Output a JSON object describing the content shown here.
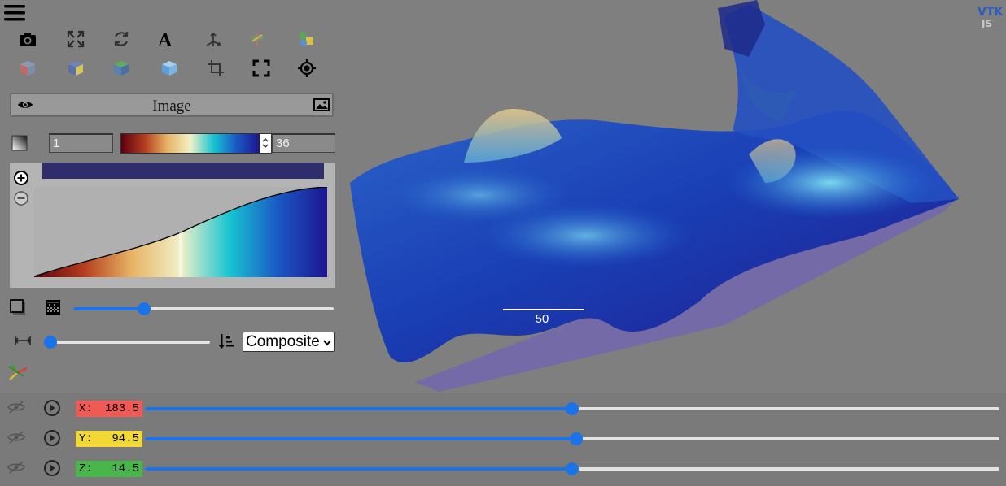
{
  "toolbar": {
    "row1": [
      {
        "icon": "camera-icon"
      },
      {
        "icon": "fullscreen-arrows-icon"
      },
      {
        "icon": "rotate-icon"
      },
      {
        "icon": "text-a-icon"
      },
      {
        "icon": "axes-arrows-icon"
      },
      {
        "icon": "plane-colored-icon"
      },
      {
        "icon": "shapes-colored-icon"
      }
    ],
    "row2": [
      {
        "icon": "cube-red-icon"
      },
      {
        "icon": "cube-yellow-icon"
      },
      {
        "icon": "cube-green-icon"
      },
      {
        "icon": "cube-blue-icon"
      },
      {
        "icon": "crop-icon"
      },
      {
        "icon": "frame-corners-icon"
      },
      {
        "icon": "target-icon"
      }
    ]
  },
  "panel": {
    "title": "Image"
  },
  "colormap": {
    "min": "1",
    "max": "36",
    "colors": [
      "#5a0010",
      "#b33c1e",
      "#e7b464",
      "#f0f0c8",
      "#18c4d1",
      "#1a58c4",
      "#1d158f"
    ]
  },
  "view": {
    "blend_options": [
      "Composite"
    ],
    "blend_mode": "Composite",
    "opacity_slider": 0.26,
    "sample_slider": 0.0
  },
  "scalebar": {
    "label": "50"
  },
  "slices": [
    {
      "axis_label": "X:",
      "value": "183.5",
      "color": "#f05a55",
      "slider": 0.5
    },
    {
      "axis_label": "Y:",
      "value": "94.5",
      "color": "#f2d835",
      "slider": 0.505
    },
    {
      "axis_label": "Z:",
      "value": "14.5",
      "color": "#49b64a",
      "slider": 0.5
    }
  ],
  "logo": {
    "text": "VTK JS"
  }
}
